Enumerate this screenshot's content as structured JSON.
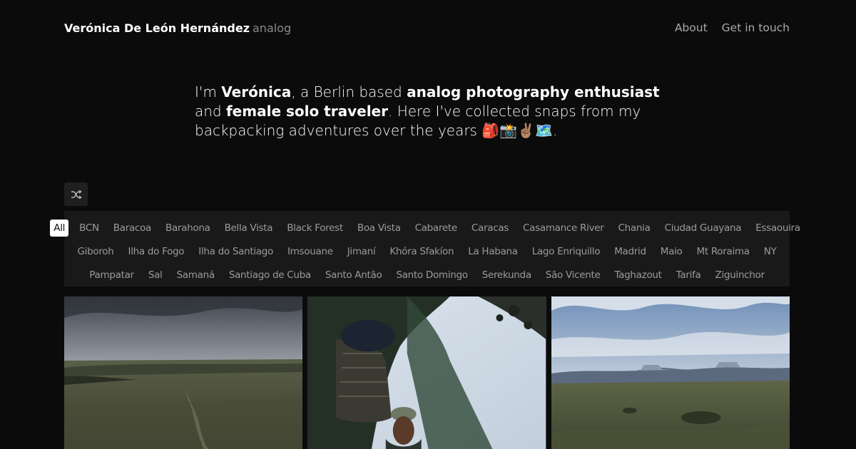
{
  "header": {
    "brand_name": "Verónica De León Hernández",
    "brand_sub": "analog",
    "nav": [
      {
        "label": "About"
      },
      {
        "label": "Get in touch"
      }
    ]
  },
  "intro": {
    "p1": "I'm ",
    "name": "Verónica",
    "p2": ", a Berlin based ",
    "b1": "analog photography enthusiast",
    "p3": " and ",
    "b2": "female solo traveler",
    "p4": ". Here I've collected snaps from my backpacking adventures over the years ",
    "emoji": "🎒📸✌🏽🗺️",
    "p5": "."
  },
  "shuffle": {
    "icon": "shuffle-icon"
  },
  "filters": {
    "rows": [
      [
        "All",
        "BCN",
        "Baracoa",
        "Barahona",
        "Bella Vista",
        "Black Forest",
        "Boa Vista",
        "Cabarete",
        "Caracas",
        "Casamance River",
        "Chania",
        "Ciudad Guayana",
        "Essaouira"
      ],
      [
        "Giboroh",
        "Ilha do Fogo",
        "Ilha do Santiago",
        "Imsouane",
        "Jimaní",
        "Khóra Sfakíon",
        "La Habana",
        "Lago Enriquillo",
        "Madrid",
        "Maio",
        "Mt Roraima",
        "NY"
      ],
      [
        "Pampatar",
        "Sal",
        "Samaná",
        "Santiago de Cuba",
        "Santo Antão",
        "Santo Domingo",
        "Serekunda",
        "São Vicente",
        "Taghazout",
        "Tarifa",
        "Ziguinchor"
      ]
    ],
    "active": "All"
  },
  "colors": {
    "background": "#0b0b0c",
    "filter_bar": "#191919",
    "active_chip": "#ffffff"
  }
}
